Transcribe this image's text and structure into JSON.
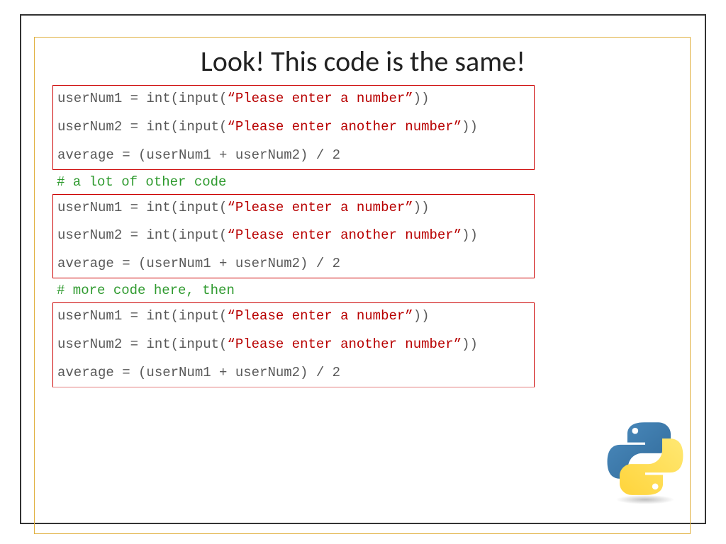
{
  "title": "Look! This code is the same!",
  "block": {
    "line1a": "userNum1 = int(input(",
    "line1b": "“Please enter a number”",
    "line1c": "))",
    "line2a": "userNum2 = int(input(",
    "line2b": "“Please enter another number”",
    "line2c": "))",
    "line3": "average = (userNum1 + userNum2) / 2"
  },
  "comment1": "# a lot of other code",
  "comment2": "# more code here, then"
}
